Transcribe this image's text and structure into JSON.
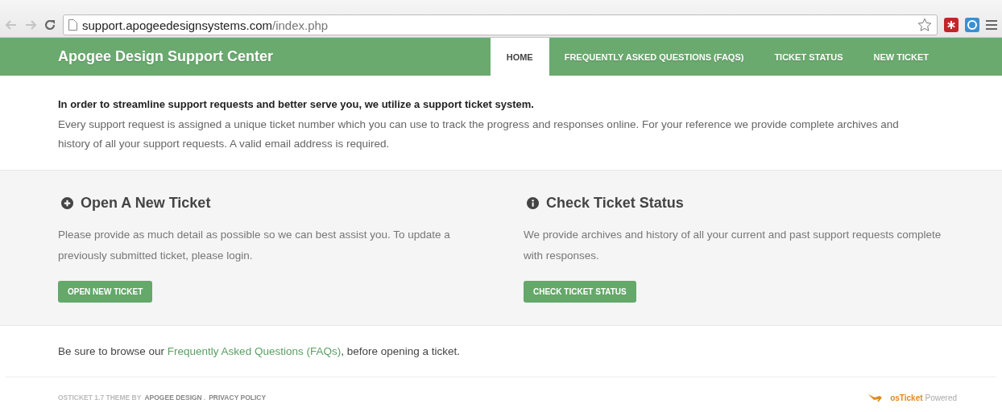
{
  "browser": {
    "url_host": "support.apogeedesignsystems.com",
    "url_path": "/index.php"
  },
  "header": {
    "title": "Apogee Design Support Center",
    "tabs": [
      {
        "label": "HOME",
        "selected": true
      },
      {
        "label": "FREQUENTLY ASKED QUESTIONS (FAQS)",
        "selected": false
      },
      {
        "label": "TICKET STATUS",
        "selected": false
      },
      {
        "label": "NEW TICKET",
        "selected": false
      }
    ]
  },
  "intro": {
    "heading": "In order to streamline support requests and better serve you, we utilize a support ticket system.",
    "text": "Every support request is assigned a unique ticket number which you can use to track the progress and responses online. For your reference we provide complete archives and history of all your support requests. A valid email address is required."
  },
  "cards": [
    {
      "kind": "plus",
      "title": "Open A New Ticket",
      "text": "Please provide as much detail as possible so we can best assist you. To update a previously submitted ticket, please login.",
      "button": "OPEN NEW TICKET"
    },
    {
      "kind": "info",
      "title": "Check Ticket Status",
      "text": "We provide archives and history of all your current and past support requests complete with responses.",
      "button": "CHECK TICKET STATUS"
    }
  ],
  "note": {
    "before": "Be sure to browse our ",
    "link": "Frequently Asked Questions (FAQs)",
    "after": ", before opening a ticket."
  },
  "footer": {
    "credit": "OSTICKET 1.7 THEME BY",
    "author": "APOGEE DESIGN",
    "separator": ".",
    "privacy": "PRIVACY POLICY",
    "brand": "osTicket",
    "powered": "Powered"
  }
}
